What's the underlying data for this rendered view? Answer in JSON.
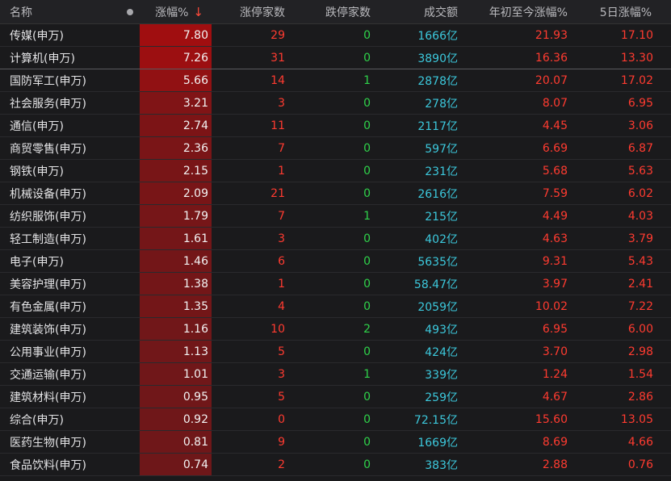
{
  "header": {
    "name": "名称",
    "pct": "涨幅%",
    "sort_arrow": "↓",
    "up": "涨停家数",
    "down": "跌停家数",
    "vol": "成交额",
    "ytd": "年初至今涨幅%",
    "d5": "5日涨幅%"
  },
  "colors": {
    "up": "#ff3b30",
    "down": "#2fd24a",
    "vol": "#3cc8dc"
  },
  "rows": [
    {
      "name": "传媒(申万)",
      "pct": "7.80",
      "pct_value": 7.8,
      "up": "29",
      "down": "0",
      "vol": "1666亿",
      "ytd": "21.93",
      "d5": "17.10"
    },
    {
      "name": "计算机(申万)",
      "pct": "7.26",
      "pct_value": 7.26,
      "up": "31",
      "down": "0",
      "vol": "3890亿",
      "ytd": "16.36",
      "d5": "13.30"
    },
    {
      "name": "国防军工(申万)",
      "pct": "5.66",
      "pct_value": 5.66,
      "up": "14",
      "down": "1",
      "vol": "2878亿",
      "ytd": "20.07",
      "d5": "17.02"
    },
    {
      "name": "社会服务(申万)",
      "pct": "3.21",
      "pct_value": 3.21,
      "up": "3",
      "down": "0",
      "vol": "278亿",
      "ytd": "8.07",
      "d5": "6.95"
    },
    {
      "name": "通信(申万)",
      "pct": "2.74",
      "pct_value": 2.74,
      "up": "11",
      "down": "0",
      "vol": "2117亿",
      "ytd": "4.45",
      "d5": "3.06"
    },
    {
      "name": "商贸零售(申万)",
      "pct": "2.36",
      "pct_value": 2.36,
      "up": "7",
      "down": "0",
      "vol": "597亿",
      "ytd": "6.69",
      "d5": "6.87"
    },
    {
      "name": "钢铁(申万)",
      "pct": "2.15",
      "pct_value": 2.15,
      "up": "1",
      "down": "0",
      "vol": "231亿",
      "ytd": "5.68",
      "d5": "5.63"
    },
    {
      "name": "机械设备(申万)",
      "pct": "2.09",
      "pct_value": 2.09,
      "up": "21",
      "down": "0",
      "vol": "2616亿",
      "ytd": "7.59",
      "d5": "6.02"
    },
    {
      "name": "纺织服饰(申万)",
      "pct": "1.79",
      "pct_value": 1.79,
      "up": "7",
      "down": "1",
      "vol": "215亿",
      "ytd": "4.49",
      "d5": "4.03"
    },
    {
      "name": "轻工制造(申万)",
      "pct": "1.61",
      "pct_value": 1.61,
      "up": "3",
      "down": "0",
      "vol": "402亿",
      "ytd": "4.63",
      "d5": "3.79"
    },
    {
      "name": "电子(申万)",
      "pct": "1.46",
      "pct_value": 1.46,
      "up": "6",
      "down": "0",
      "vol": "5635亿",
      "ytd": "9.31",
      "d5": "5.43"
    },
    {
      "name": "美容护理(申万)",
      "pct": "1.38",
      "pct_value": 1.38,
      "up": "1",
      "down": "0",
      "vol": "58.47亿",
      "ytd": "3.97",
      "d5": "2.41"
    },
    {
      "name": "有色金属(申万)",
      "pct": "1.35",
      "pct_value": 1.35,
      "up": "4",
      "down": "0",
      "vol": "2059亿",
      "ytd": "10.02",
      "d5": "7.22"
    },
    {
      "name": "建筑装饰(申万)",
      "pct": "1.16",
      "pct_value": 1.16,
      "up": "10",
      "down": "2",
      "vol": "493亿",
      "ytd": "6.95",
      "d5": "6.00"
    },
    {
      "name": "公用事业(申万)",
      "pct": "1.13",
      "pct_value": 1.13,
      "up": "5",
      "down": "0",
      "vol": "424亿",
      "ytd": "3.70",
      "d5": "2.98"
    },
    {
      "name": "交通运输(申万)",
      "pct": "1.01",
      "pct_value": 1.01,
      "up": "3",
      "down": "1",
      "vol": "339亿",
      "ytd": "1.24",
      "d5": "1.54"
    },
    {
      "name": "建筑材料(申万)",
      "pct": "0.95",
      "pct_value": 0.95,
      "up": "5",
      "down": "0",
      "vol": "259亿",
      "ytd": "4.67",
      "d5": "2.86"
    },
    {
      "name": "综合(申万)",
      "pct": "0.92",
      "pct_value": 0.92,
      "up": "0",
      "down": "0",
      "vol": "72.15亿",
      "ytd": "15.60",
      "d5": "13.05"
    },
    {
      "name": "医药生物(申万)",
      "pct": "0.81",
      "pct_value": 0.81,
      "up": "9",
      "down": "0",
      "vol": "1669亿",
      "ytd": "8.69",
      "d5": "4.66"
    },
    {
      "name": "食品饮料(申万)",
      "pct": "0.74",
      "pct_value": 0.74,
      "up": "2",
      "down": "0",
      "vol": "383亿",
      "ytd": "2.88",
      "d5": "0.76"
    }
  ]
}
